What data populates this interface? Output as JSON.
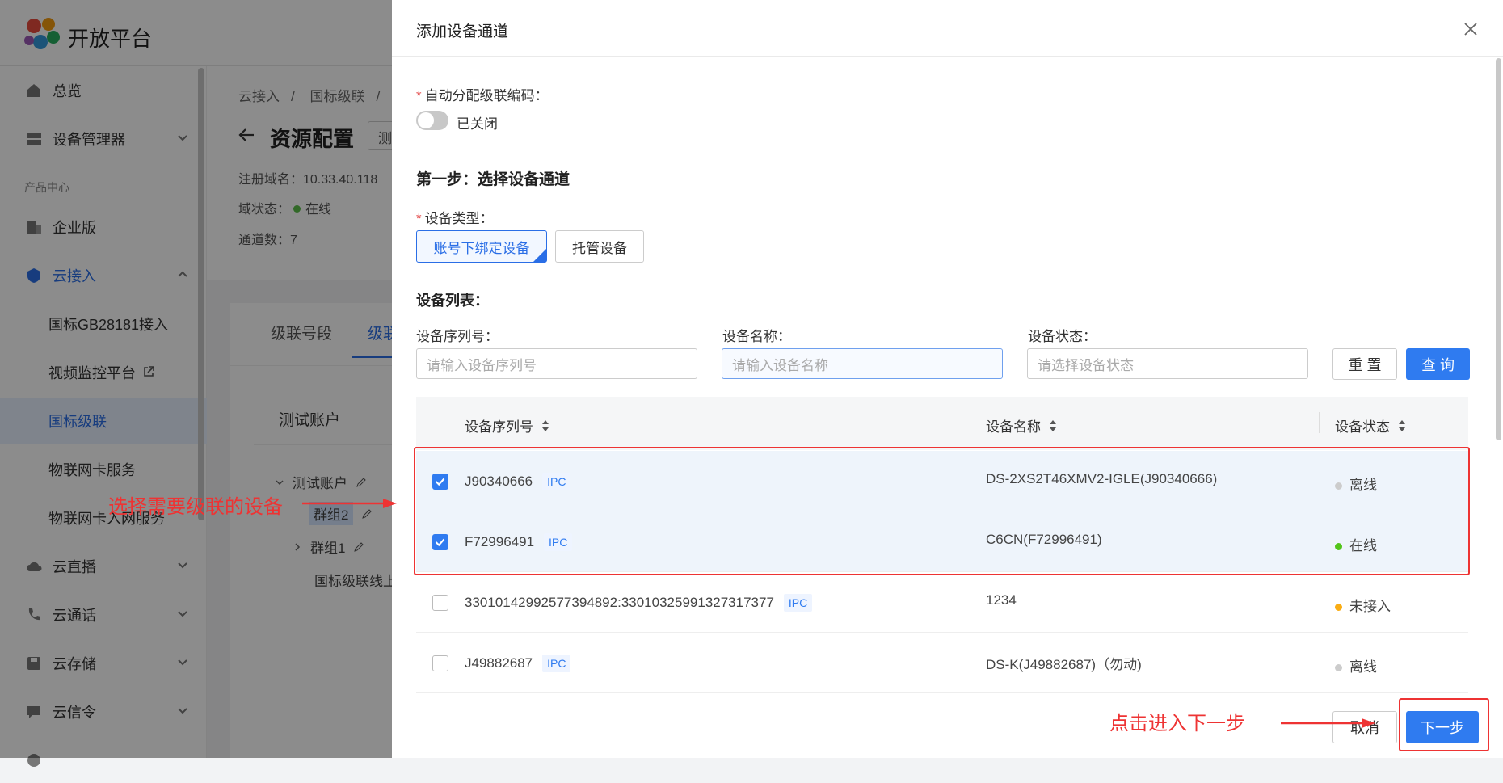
{
  "app": {
    "brand": "开放平台"
  },
  "sidebar": {
    "items": [
      {
        "label": "总览"
      },
      {
        "label": "设备管理器"
      },
      {
        "label": "企业版"
      },
      {
        "label": "云接入"
      },
      {
        "label": "国标GB28181接入"
      },
      {
        "label": "视频监控平台"
      },
      {
        "label": "国标级联"
      },
      {
        "label": "物联网卡服务"
      },
      {
        "label": "物联网卡入网服务"
      },
      {
        "label": "云直播"
      },
      {
        "label": "云通话"
      },
      {
        "label": "云存储"
      },
      {
        "label": "云信令"
      }
    ],
    "section_label": "产品中心"
  },
  "main": {
    "breadcrumb": [
      "云接入",
      "国标级联"
    ],
    "crumb_sep": "/",
    "title": "资源配置",
    "title_input_value": "测",
    "domain_label": "注册域名：10.33.40.118",
    "status_label": "域状态：",
    "status_value": "在线",
    "channels_label": "通道数：7",
    "tabs": [
      "级联号段",
      "级联"
    ],
    "tree": {
      "header": "测试账户",
      "nodes": [
        "测试账户",
        "群组2",
        "群组1",
        "国标级联线上"
      ]
    }
  },
  "drawer": {
    "title": "添加设备通道",
    "auto_label": "自动分配级联编码：",
    "switch_text": "已关闭",
    "step_title": "第一步：选择设备通道",
    "device_type_label": "设备类型：",
    "device_types": [
      "账号下绑定设备",
      "托管设备"
    ],
    "list_title": "设备列表：",
    "filters": {
      "serial_label": "设备序列号：",
      "serial_placeholder": "请输入设备序列号",
      "name_label": "设备名称：",
      "name_placeholder": "请输入设备名称",
      "status_label": "设备状态：",
      "status_placeholder": "请选择设备状态"
    },
    "reset_label": "重 置",
    "query_label": "查 询",
    "columns": [
      "设备序列号",
      "设备名称",
      "设备状态"
    ],
    "rows": [
      {
        "serial": "J90340666",
        "tag": "IPC",
        "name": "DS-2XS2T46XMV2-IGLE(J90340666)",
        "status": "离线",
        "checked": true,
        "color": "#cccccc"
      },
      {
        "serial": "F72996491",
        "tag": "IPC",
        "name": "C6CN(F72996491)",
        "status": "在线",
        "checked": true,
        "color": "#52c41a"
      },
      {
        "serial": "33010142992577394892:33010325991327317377",
        "tag": "IPC",
        "name": "1234",
        "status": "未接入",
        "checked": false,
        "color": "#faad14"
      },
      {
        "serial": "J49882687",
        "tag": "IPC",
        "name": "DS-K(J49882687)（勿动)",
        "status": "离线",
        "checked": false,
        "color": "#cccccc"
      }
    ],
    "cancel_label": "取消",
    "next_label": "下一步"
  },
  "annotations": {
    "select_hint": "选择需要级联的设备",
    "next_hint": "点击进入下一步",
    "highlight_color": "#e33333"
  }
}
